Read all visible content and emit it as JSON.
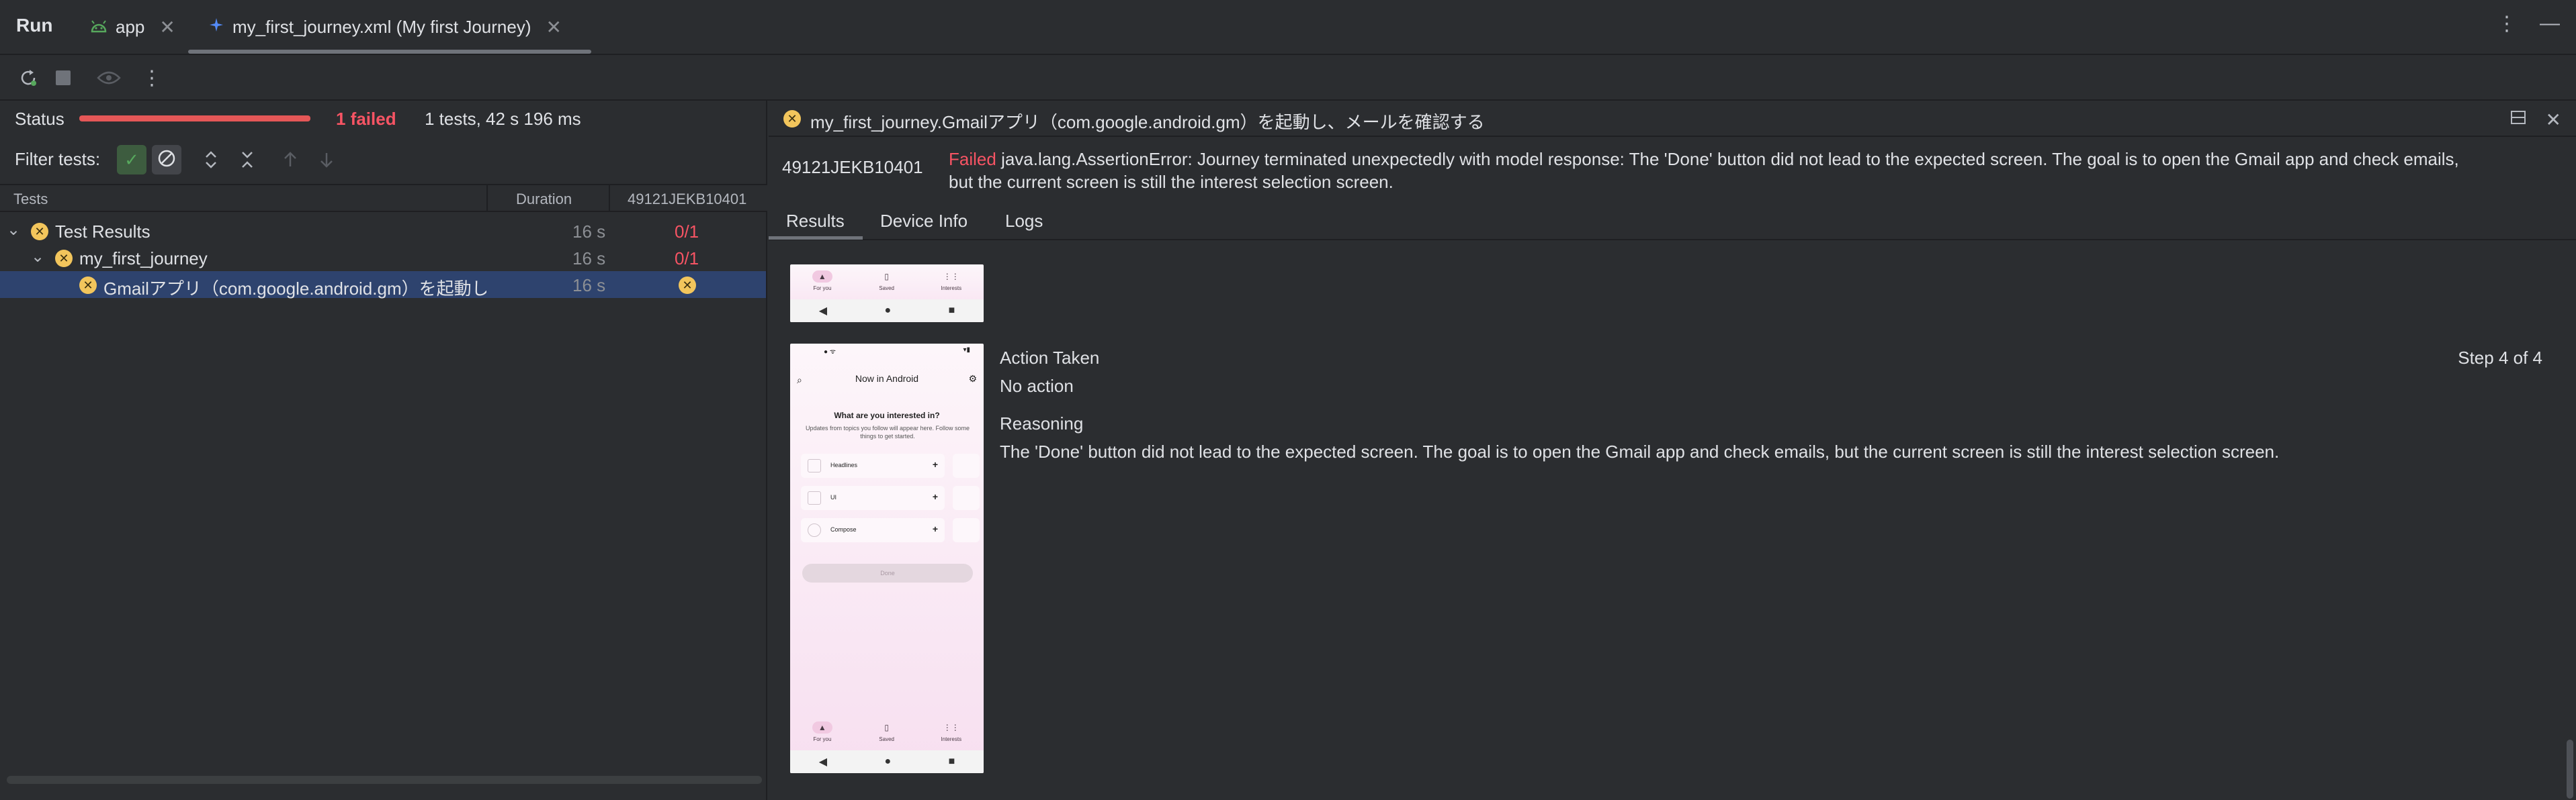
{
  "tabbar": {
    "run_label": "Run",
    "tabs": [
      {
        "label": "app",
        "icon": "android-icon"
      },
      {
        "label": "my_first_journey.xml (My first Journey)",
        "icon": "journey-icon"
      }
    ]
  },
  "status": {
    "label": "Status",
    "failed": "1 failed",
    "summary": "1 tests, 42 s 196 ms"
  },
  "filter": {
    "label": "Filter tests:"
  },
  "tree": {
    "headers": {
      "tests": "Tests",
      "duration": "Duration",
      "device": "49121JEKB10401"
    },
    "rows": [
      {
        "name": "Test Results",
        "duration": "16 s",
        "result": "0/1"
      },
      {
        "name": "my_first_journey",
        "duration": "16 s",
        "result": "0/1"
      },
      {
        "name": "Gmailアプリ（com.google.android.gm）を起動し",
        "duration": "16 s",
        "result": ""
      }
    ]
  },
  "detail": {
    "title": "my_first_journey.Gmailアプリ（com.google.android.gm）を起動し、メールを確認する",
    "device_id": "49121JEKB10401",
    "error_status": "Failed",
    "error_line1": "java.lang.AssertionError: Journey terminated unexpectedly with model response: The 'Done' button did not lead to the expected screen. The goal is to open the Gmail app and check emails,",
    "error_line2": "but the current screen is still the interest selection screen.",
    "tabs": [
      "Results",
      "Device Info",
      "Logs"
    ]
  },
  "step": {
    "action_label": "Action Taken",
    "action_value": "No action",
    "reasoning_label": "Reasoning",
    "reasoning_value": "The 'Done' button did not lead to the expected screen. The goal is to open the Gmail app and check emails, but the current screen is still the interest selection screen.",
    "counter": "Step 4 of 4"
  },
  "phone": {
    "app_title": "Now in Android",
    "question": "What are you interested in?",
    "subtitle": "Updates from topics you follow will appear here. Follow some things to get started.",
    "items": [
      "Headlines",
      "UI",
      "Compose"
    ],
    "done": "Done",
    "bottom_tabs": [
      "For you",
      "Saved",
      "Interests"
    ]
  },
  "colors": {
    "failed": "#f75464",
    "fail_icon": "#f2c55c",
    "selected_row": "#2e436e",
    "status_bar": "#e55757"
  }
}
